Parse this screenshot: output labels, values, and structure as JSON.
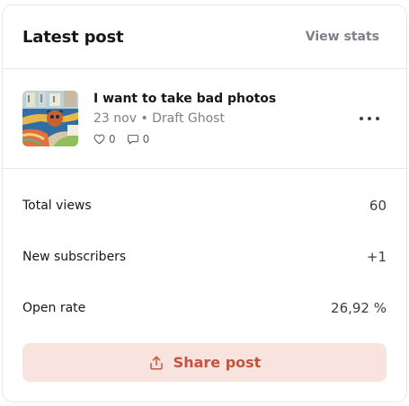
{
  "header": {
    "title": "Latest post",
    "view_stats_label": "View stats"
  },
  "post": {
    "title": "I want to take bad photos",
    "meta": "23 nov • Draft Ghost",
    "likes": "0",
    "comments": "0"
  },
  "metrics": [
    {
      "label": "Total views",
      "value": "60"
    },
    {
      "label": "New subscribers",
      "value": "+1"
    },
    {
      "label": "Open rate",
      "value": "26,92 %"
    }
  ],
  "share": {
    "label": "Share post"
  },
  "icons": {
    "heart": "heart-icon",
    "comment": "comment-icon",
    "more": "more-icon",
    "share": "share-icon"
  },
  "colors": {
    "accent": "#c2553f",
    "accent_bg": "#f8e3df",
    "muted": "#7c8189",
    "border": "#e6e7ea"
  }
}
